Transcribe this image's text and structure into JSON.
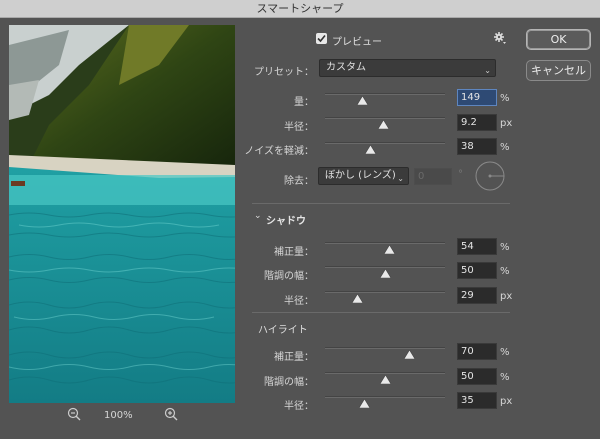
{
  "window": {
    "title": "スマートシャープ"
  },
  "preview": {
    "zoom": "100%",
    "checkbox_label": "プレビュー",
    "checked": true
  },
  "buttons": {
    "ok": "OK",
    "cancel": "キャンセル"
  },
  "preset": {
    "label": "プリセット：",
    "value": "カスタム"
  },
  "main": {
    "amount": {
      "label": "量：",
      "value": "149",
      "unit": "%",
      "level": 0.31
    },
    "radius": {
      "label": "半径：",
      "value": "9.2",
      "unit": "px",
      "level": 0.49
    },
    "noise": {
      "label": "ノイズを軽減：",
      "value": "38",
      "unit": "%",
      "level": 0.38
    },
    "remove": {
      "label": "除去：",
      "value": "ぼかし (レンズ)",
      "angle_value": "0",
      "angle_unit": "°"
    }
  },
  "shadow": {
    "header": "シャドウ",
    "fade": {
      "label": "補正量：",
      "value": "54",
      "unit": "%",
      "level": 0.54
    },
    "tonal": {
      "label": "階調の幅：",
      "value": "50",
      "unit": "%",
      "level": 0.5
    },
    "radius": {
      "label": "半径：",
      "value": "29",
      "unit": "px",
      "level": 0.27
    }
  },
  "highlight": {
    "header": "ハイライト",
    "fade": {
      "label": "補正量：",
      "value": "70",
      "unit": "%",
      "level": 0.7
    },
    "tonal": {
      "label": "階調の幅：",
      "value": "50",
      "unit": "%",
      "level": 0.5
    },
    "radius": {
      "label": "半径：",
      "value": "35",
      "unit": "px",
      "level": 0.33
    }
  }
}
